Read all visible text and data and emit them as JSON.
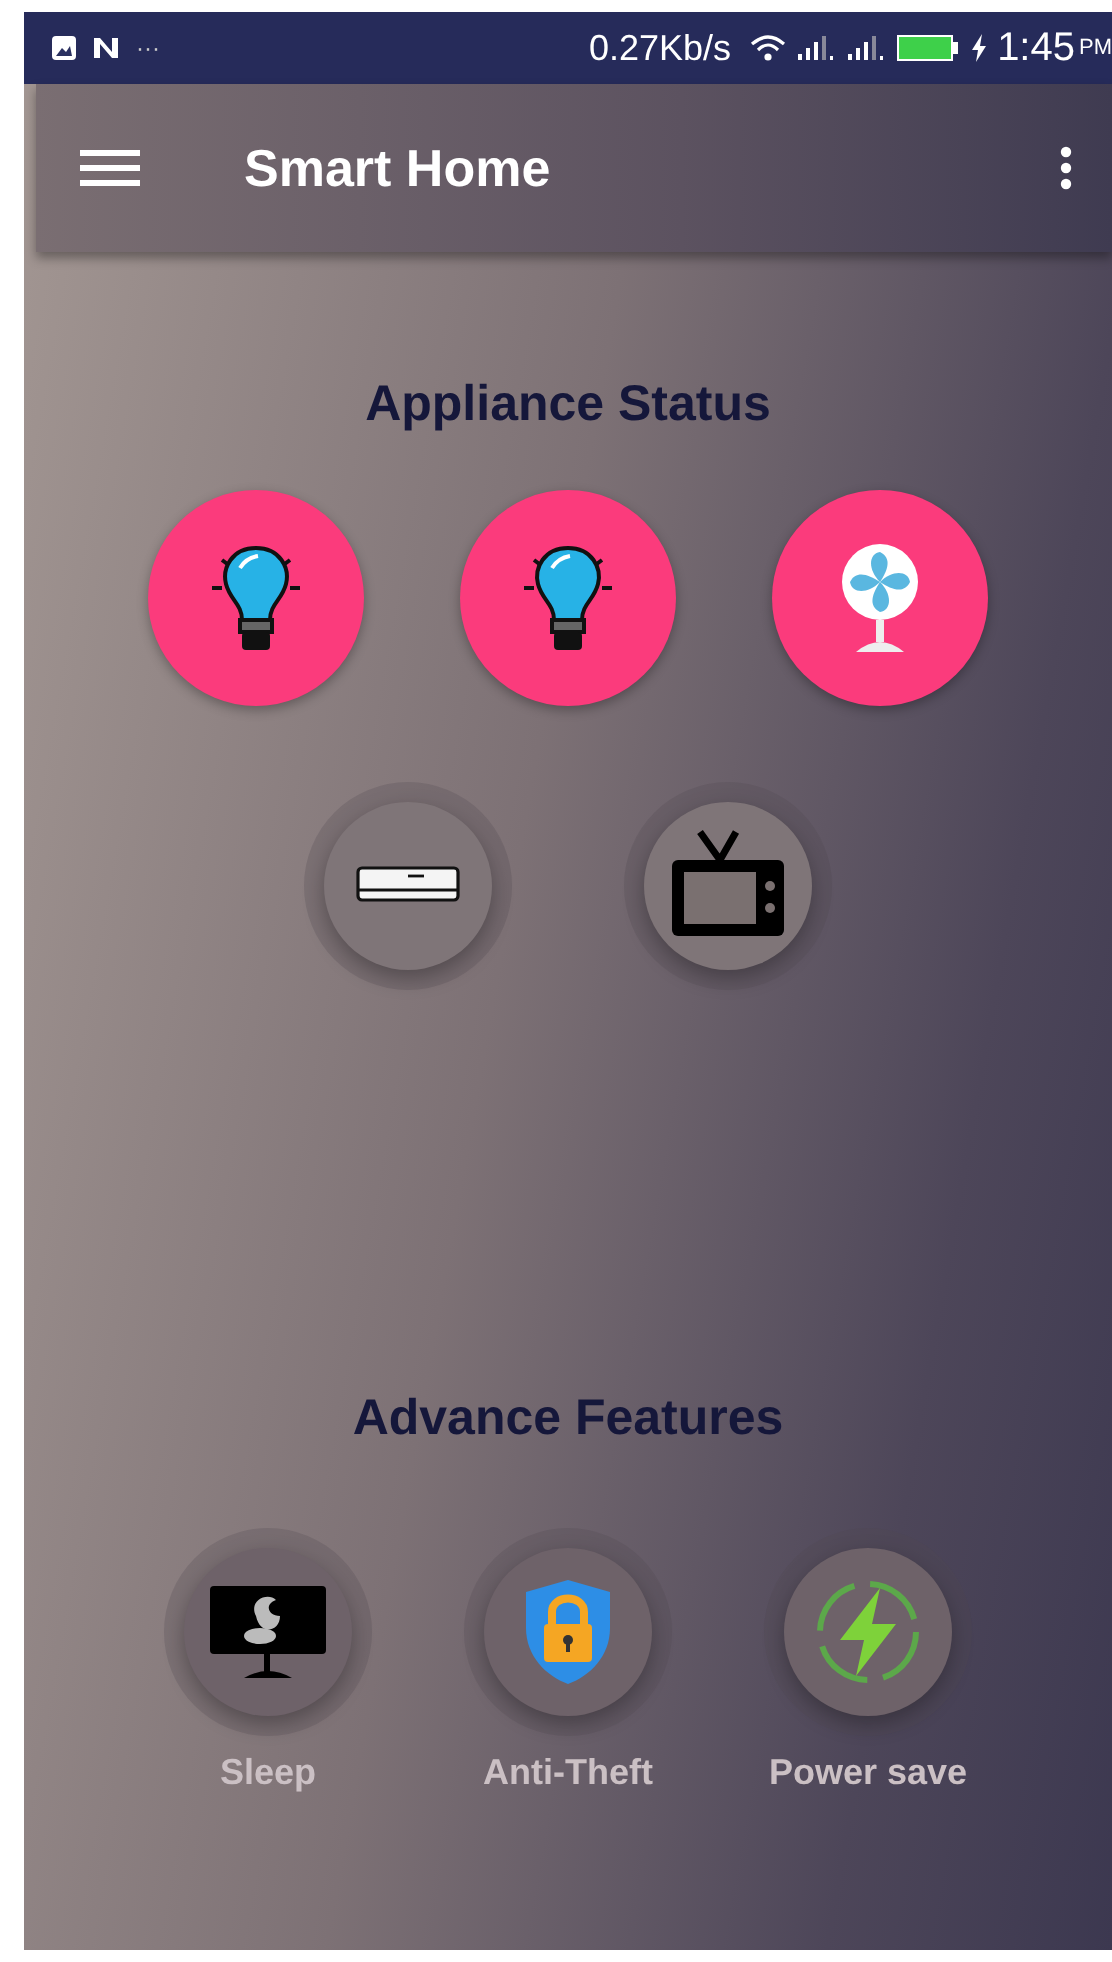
{
  "status_bar": {
    "speed": "0.27Kb/s",
    "time": "1:45",
    "ampm": "PM",
    "more": "···"
  },
  "app_bar": {
    "title": "Smart Home"
  },
  "appliance_section": {
    "title": "Appliance Status"
  },
  "appliances": [
    {
      "kind": "bulb",
      "on": true
    },
    {
      "kind": "bulb",
      "on": true
    },
    {
      "kind": "fan",
      "on": true
    },
    {
      "kind": "ac",
      "on": false
    },
    {
      "kind": "tv",
      "on": false
    }
  ],
  "features_section": {
    "title": "Advance Features"
  },
  "features": [
    {
      "kind": "sleep",
      "label": "Sleep"
    },
    {
      "kind": "shield",
      "label": "Anti-Theft"
    },
    {
      "kind": "power",
      "label": "Power save"
    }
  ]
}
